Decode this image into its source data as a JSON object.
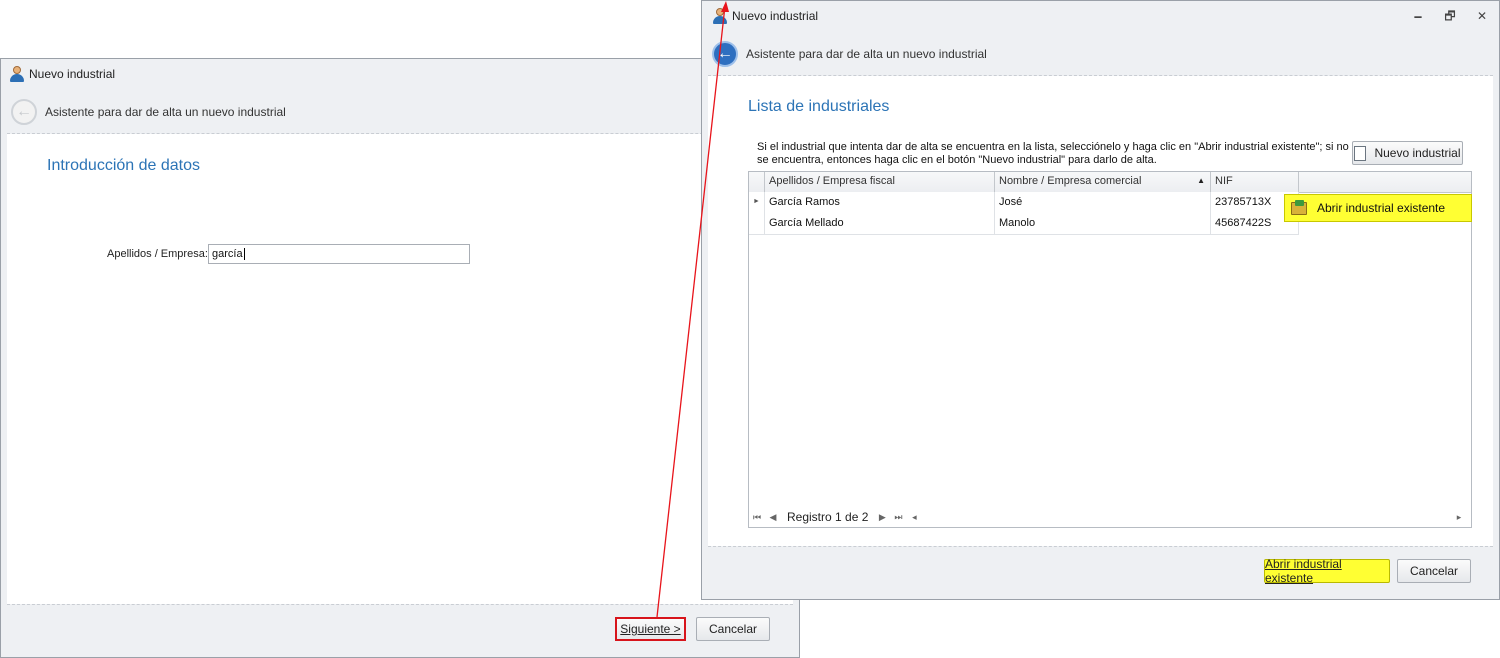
{
  "left_window": {
    "title": "Nuevo industrial",
    "wizard_title": "Asistente para dar de alta un nuevo industrial",
    "section_title": "Introducción de datos",
    "field_label": "Apellidos / Empresa:",
    "field_value": "garcía",
    "next_button": "Siguiente >",
    "cancel_button": "Cancelar"
  },
  "right_window": {
    "title": "Nuevo industrial",
    "window_buttons": {
      "minimize": "🗕",
      "restore": "🗗",
      "close": "✕"
    },
    "wizard_title": "Asistente para dar de alta un nuevo industrial",
    "section_title": "Lista de industriales",
    "instructions_line1": "Si el industrial que intenta dar de alta se encuentra en la lista, selecciónelo y haga clic en \"Abrir industrial existente\"; si no",
    "instructions_line2": "se encuentra, entonces  haga clic en el botón \"Nuevo industrial\" para darlo de alta.",
    "new_button": "Nuevo industrial",
    "grid": {
      "columns": [
        "Apellidos / Empresa fiscal",
        "Nombre / Empresa comercial",
        "NIF"
      ],
      "sorted_column_indicator": "▲",
      "rows": [
        {
          "indicator": "►",
          "apellidos": "García Ramos",
          "nombre": "José",
          "nif": "23785713X"
        },
        {
          "indicator": "",
          "apellidos": "García Mellado",
          "nombre": "Manolo",
          "nif": "45687422S"
        }
      ],
      "record_text": "Registro 1 de 2",
      "nav_icons": {
        "first": "⏮",
        "prev": "◀",
        "next": "▶",
        "last": "⏭",
        "scroll_left": "◂",
        "scroll_right": "▸"
      }
    },
    "context_action": "Abrir industrial existente",
    "open_button": "Abrir industrial existente",
    "cancel_button": "Cancelar"
  },
  "colors": {
    "highlight_yellow": "#ffff33",
    "annotation_red": "#e8141b",
    "section_blue": "#2c74b6"
  }
}
